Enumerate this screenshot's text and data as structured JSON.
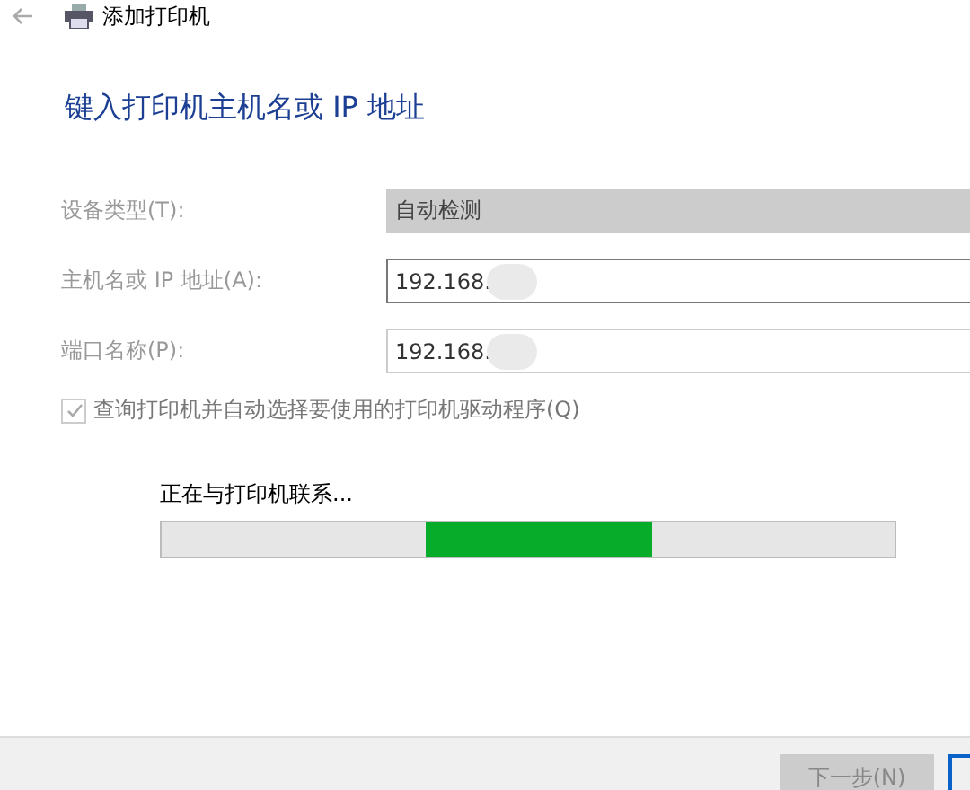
{
  "window": {
    "title": "添加打印机"
  },
  "heading": "键入打印机主机名或 IP 地址",
  "fields": [
    {
      "label": "设备类型(T):",
      "value": "自动检测",
      "disabled": true,
      "focused": false
    },
    {
      "label": "主机名或 IP 地址(A):",
      "value": "192.168.",
      "disabled": false,
      "focused": true
    },
    {
      "label": "端口名称(P):",
      "value": "192.168.",
      "disabled": false,
      "focused": false
    }
  ],
  "query_checkbox": {
    "label": "查询打印机并自动选择要使用的打印机驱动程序(Q)",
    "checked": true,
    "disabled": true
  },
  "progress": {
    "label": "正在与打印机联系..."
  },
  "buttons": [
    {
      "label": "下一步(N)",
      "disabled": true
    }
  ]
}
